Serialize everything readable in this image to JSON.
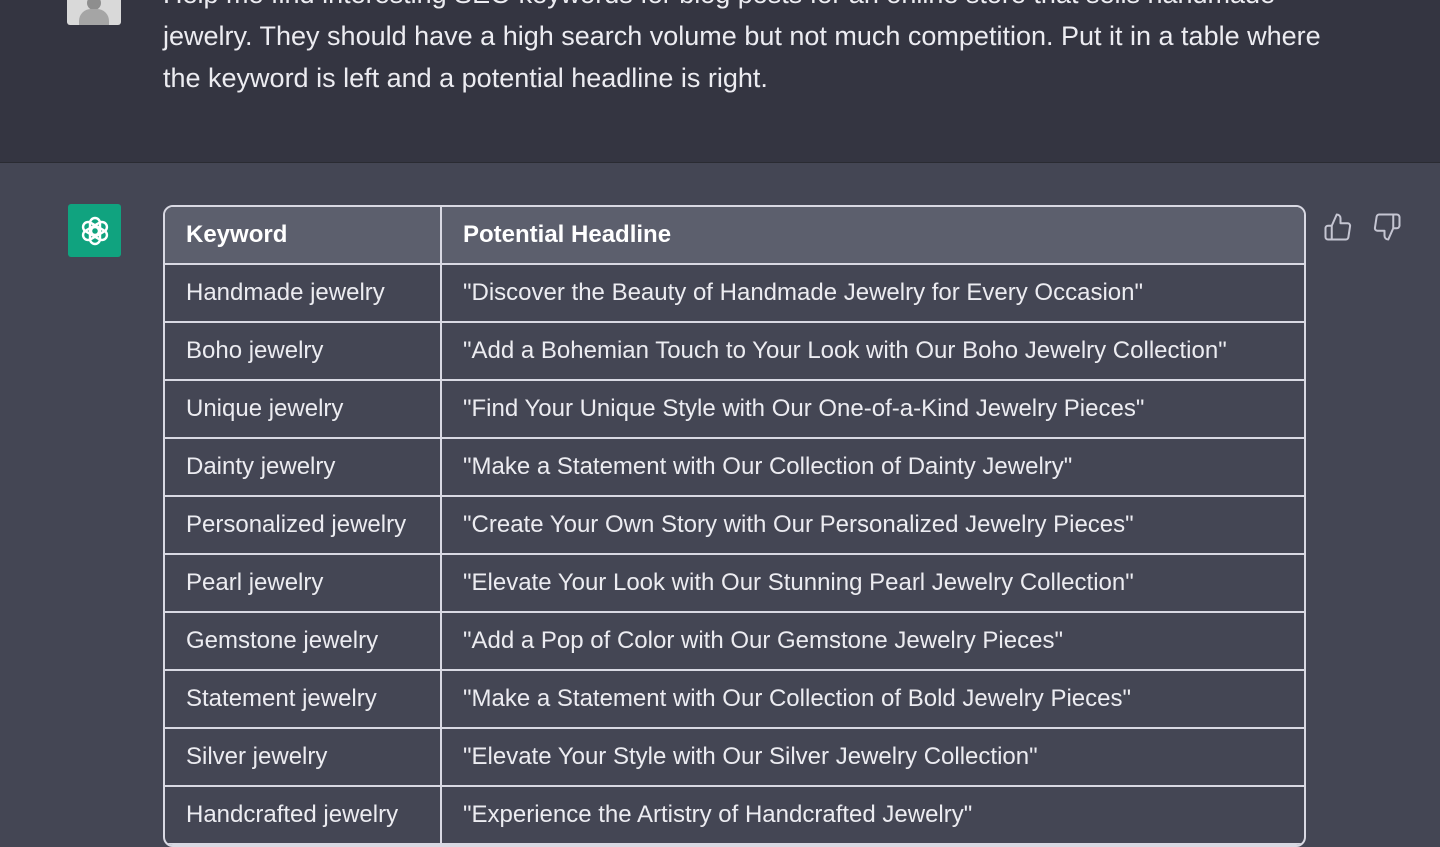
{
  "user_message": {
    "text": "Help me find interesting SEO keywords for blog posts for an online store that sells handmade jewelry. They should have a high search volume but not much competition. Put it in a table where the keyword is left and a potential headline is right."
  },
  "assistant_message": {
    "table": {
      "headers": [
        "Keyword",
        "Potential Headline"
      ],
      "rows": [
        [
          "Handmade jewelry",
          "\"Discover the Beauty of Handmade Jewelry for Every Occasion\""
        ],
        [
          "Boho jewelry",
          "\"Add a Bohemian Touch to Your Look with Our Boho Jewelry Collection\""
        ],
        [
          "Unique jewelry",
          "\"Find Your Unique Style with Our One-of-a-Kind Jewelry Pieces\""
        ],
        [
          "Dainty jewelry",
          "\"Make a Statement with Our Collection of Dainty Jewelry\""
        ],
        [
          "Personalized jewelry",
          "\"Create Your Own Story with Our Personalized Jewelry Pieces\""
        ],
        [
          "Pearl jewelry",
          "\"Elevate Your Look with Our Stunning Pearl Jewelry Collection\""
        ],
        [
          "Gemstone jewelry",
          "\"Add a Pop of Color with Our Gemstone Jewelry Pieces\""
        ],
        [
          "Statement jewelry",
          "\"Make a Statement with Our Collection of Bold Jewelry Pieces\""
        ],
        [
          "Silver jewelry",
          "\"Elevate Your Style with Our Silver Jewelry Collection\""
        ],
        [
          "Handcrafted jewelry",
          "\"Experience the Artistry of Handcrafted Jewelry\""
        ]
      ]
    }
  },
  "icons": {
    "user_avatar": "user-avatar-photo",
    "assistant_avatar": "openai-logo-icon",
    "feedback": [
      "thumbs-up-icon",
      "thumbs-down-icon"
    ]
  },
  "colors": {
    "user_bg": "#343541",
    "assistant_bg": "#444654",
    "assistant_avatar_bg": "#10a37f",
    "table_header_bg": "#5c5f6d",
    "table_border": "#d9d9e3"
  }
}
